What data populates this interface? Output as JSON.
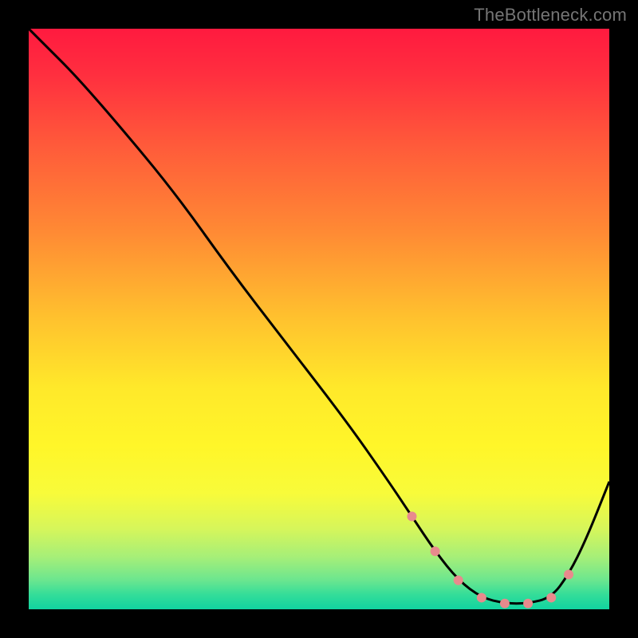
{
  "watermark": "TheBottleneck.com",
  "colors": {
    "bg": "#000000",
    "line": "#000000",
    "marker": "#e88a8d",
    "gradient_stops": [
      {
        "offset": 0.0,
        "color": "#ff1a3f"
      },
      {
        "offset": 0.08,
        "color": "#ff2f3f"
      },
      {
        "offset": 0.2,
        "color": "#ff5a3a"
      },
      {
        "offset": 0.35,
        "color": "#ff8a34"
      },
      {
        "offset": 0.5,
        "color": "#ffc22e"
      },
      {
        "offset": 0.62,
        "color": "#ffe92a"
      },
      {
        "offset": 0.72,
        "color": "#fff629"
      },
      {
        "offset": 0.8,
        "color": "#f8fb3a"
      },
      {
        "offset": 0.86,
        "color": "#d7f65a"
      },
      {
        "offset": 0.91,
        "color": "#a6ef78"
      },
      {
        "offset": 0.95,
        "color": "#6be68f"
      },
      {
        "offset": 0.975,
        "color": "#33dd99"
      },
      {
        "offset": 1.0,
        "color": "#11d4a0"
      }
    ]
  },
  "chart_data": {
    "type": "line",
    "title": "",
    "xlabel": "",
    "ylabel": "",
    "xlim": [
      0,
      100
    ],
    "ylim": [
      0,
      100
    ],
    "x": [
      0,
      3,
      8,
      15,
      25,
      35,
      45,
      55,
      62,
      66,
      70,
      74,
      78,
      82,
      86,
      90,
      93,
      96,
      100
    ],
    "values": [
      100,
      97,
      92,
      84,
      72,
      58,
      45,
      32,
      22,
      16,
      10,
      5,
      2,
      1,
      1,
      2,
      6,
      12,
      22
    ],
    "marker_indices": [
      9,
      10,
      11,
      12,
      13,
      14,
      15,
      16
    ]
  }
}
